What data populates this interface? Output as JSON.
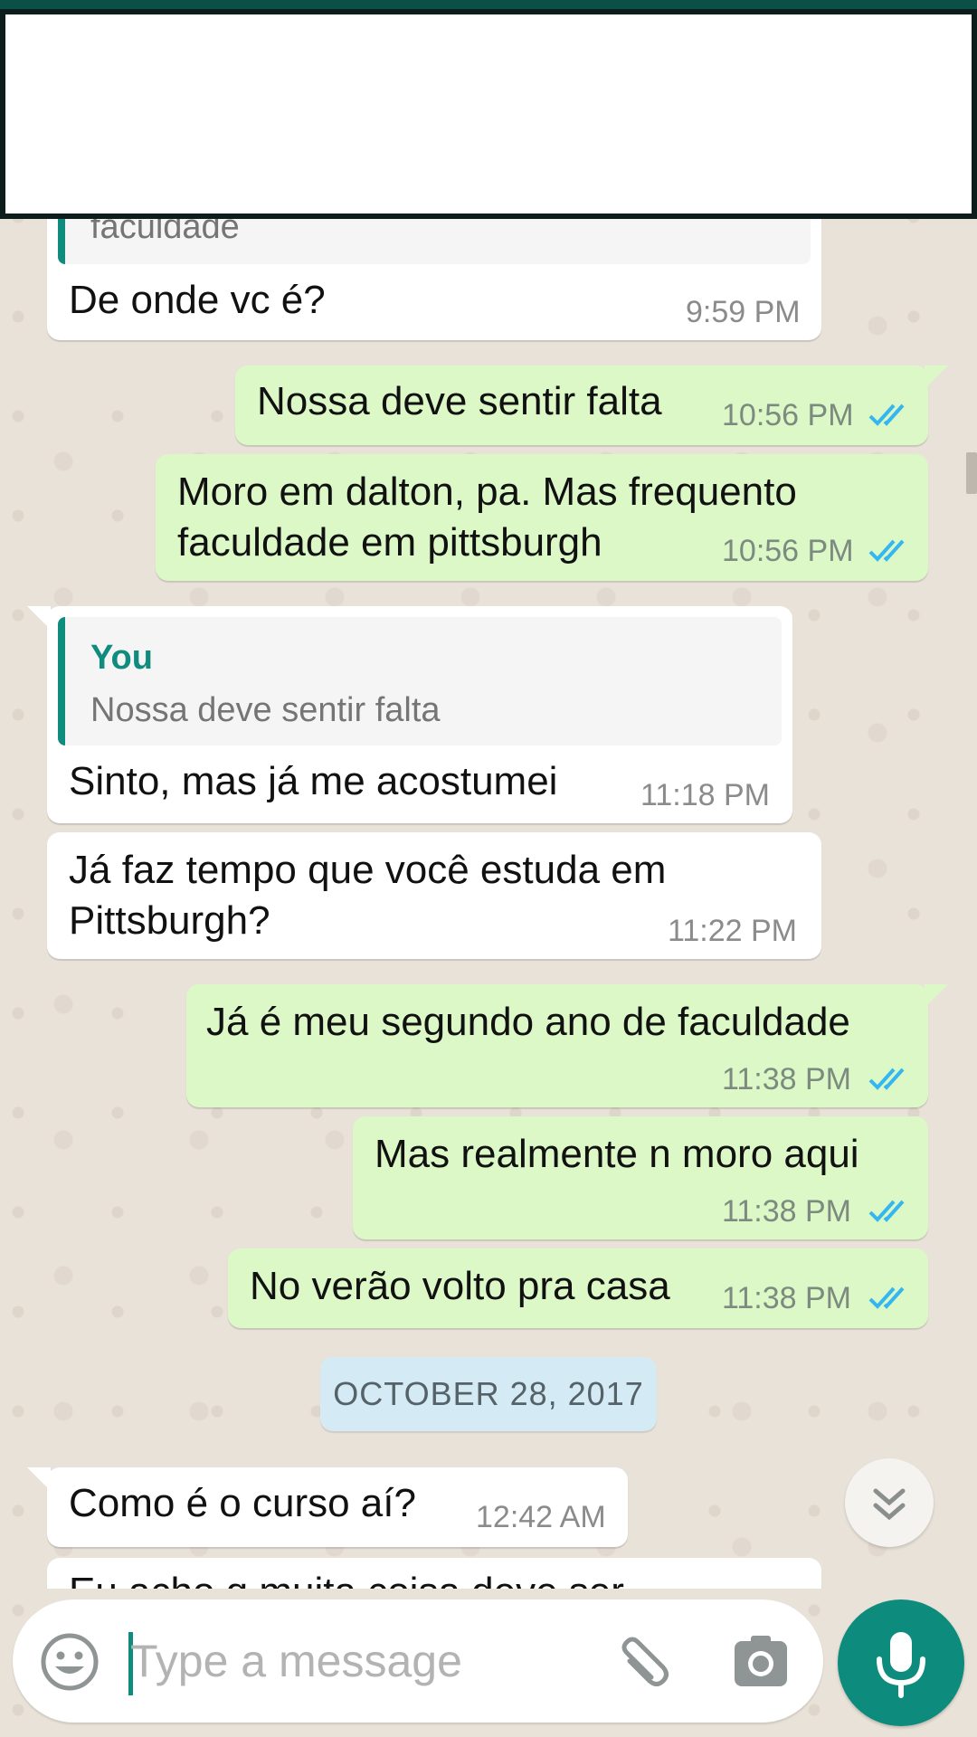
{
  "colors": {
    "accent_teal": "#0f8c7e",
    "outgoing_bubble": "#dcf8c6",
    "incoming_bubble": "#ffffff",
    "read_ticks": "#34b7f1",
    "date_chip": "#d4eaf4"
  },
  "messages": [
    {
      "direction": "in",
      "quote_text_partial": "faculdade",
      "text": "De onde vc é?",
      "time": "9:59 PM"
    },
    {
      "direction": "out",
      "text": "Nossa deve sentir falta",
      "time": "10:56 PM",
      "status": "read"
    },
    {
      "direction": "out",
      "text": "Moro em dalton, pa. Mas frequento\nfaculdade em pittsburgh",
      "time": "10:56 PM",
      "status": "read"
    },
    {
      "direction": "in",
      "quote": {
        "author": "You",
        "text": "Nossa deve sentir falta"
      },
      "text": "Sinto, mas já me acostumei",
      "time": "11:18 PM"
    },
    {
      "direction": "in",
      "text": "Já faz tempo que você estuda em\nPittsburgh?",
      "time": "11:22 PM"
    },
    {
      "direction": "out",
      "text": "Já é meu segundo ano de faculdade",
      "time": "11:38 PM",
      "status": "read"
    },
    {
      "direction": "out",
      "text": "Mas realmente n moro aqui",
      "time": "11:38 PM",
      "status": "read"
    },
    {
      "direction": "out",
      "text": "No verão volto pra casa",
      "time": "11:38 PM",
      "status": "read"
    },
    {
      "direction": "in",
      "text": "Como é o curso aí?",
      "time": "12:42 AM"
    },
    {
      "direction": "in",
      "text_partial": "Eu acho q muita coisa deve ser"
    }
  ],
  "date_separator": "OCTOBER 28, 2017",
  "composer": {
    "placeholder": "Type a message",
    "emoji_icon": "emoji-icon",
    "attach_icon": "paperclip-icon",
    "camera_icon": "camera-icon",
    "mic_icon": "microphone-icon"
  },
  "scroll_down_icon": "double-chevron-down-icon"
}
